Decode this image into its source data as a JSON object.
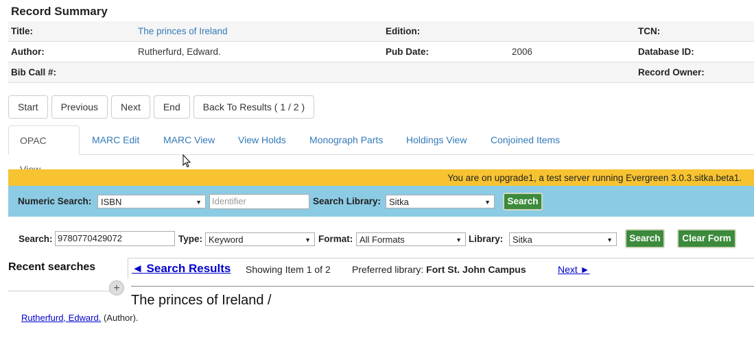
{
  "summary": {
    "heading": "Record Summary",
    "rows": [
      {
        "l1": "Title:",
        "v1": "The princes of Ireland",
        "l2": "Edition:",
        "v2": "",
        "l3": "TCN:",
        "v3": ""
      },
      {
        "l1": "Author:",
        "v1": "Rutherfurd, Edward.",
        "l2": "Pub Date:",
        "v2": "2006",
        "l3": "Database ID:",
        "v3": ""
      },
      {
        "l1": "Bib Call #:",
        "v1": "",
        "l2": "",
        "v2": "",
        "l3": "Record Owner:",
        "v3": ""
      }
    ]
  },
  "pager": {
    "start": "Start",
    "previous": "Previous",
    "next": "Next",
    "end": "End",
    "back": "Back To Results ( 1 / 2 )"
  },
  "tabs": [
    "OPAC View",
    "MARC Edit",
    "MARC View",
    "View Holds",
    "Monograph Parts",
    "Holdings View",
    "Conjoined Items"
  ],
  "banner": "You are on upgrade1, a test server running Evergreen 3.0.3.sitka.beta1.",
  "numeric": {
    "label": "Numeric Search:",
    "type_value": "ISBN",
    "identifier_placeholder": "Identifier",
    "library_label": "Search Library:",
    "library_value": "Sitka",
    "search_button": "Search"
  },
  "search": {
    "label": "Search:",
    "value": "9780770429072",
    "type_label": "Type:",
    "type_value": "Keyword",
    "format_label": "Format:",
    "format_value": "All Formats",
    "library_label": "Library:",
    "library_value": "Sitka",
    "search_button": "Search",
    "clear_button": "Clear Form"
  },
  "recent_searches": "Recent searches",
  "results": {
    "back_link": "◄ Search Results",
    "showing": "Showing Item 1 of 2",
    "preferred_label": "Preferred library:",
    "preferred_value": "Fort St. John Campus",
    "next_link": "Next ►"
  },
  "record": {
    "title": "The princes of Ireland /",
    "author_link": "Rutherfurd, Edward.",
    "author_role": "(Author)."
  },
  "colors": {
    "banner": "#f7c331",
    "numbar": "#8ccbe4",
    "green": "#3c8a3c",
    "link": "#337ab7"
  }
}
